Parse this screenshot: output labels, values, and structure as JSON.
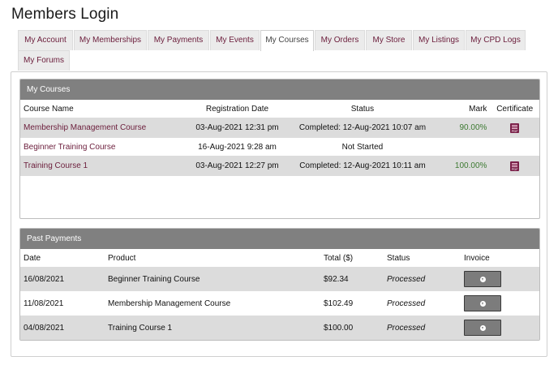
{
  "page": {
    "title": "Members Login"
  },
  "tabs": [
    {
      "label": "My Account"
    },
    {
      "label": "My Memberships"
    },
    {
      "label": "My Payments"
    },
    {
      "label": "My Events"
    },
    {
      "label": "My Courses",
      "active": true
    },
    {
      "label": "My Orders"
    },
    {
      "label": "My Store"
    },
    {
      "label": "My Listings"
    },
    {
      "label": "My CPD Logs"
    },
    {
      "label": "My Forums"
    }
  ],
  "courses": {
    "header": "My Courses",
    "columns": {
      "name": "Course Name",
      "date": "Registration Date",
      "status": "Status",
      "mark": "Mark",
      "certificate": "Certificate"
    },
    "rows": [
      {
        "name": "Membership Management Course",
        "date": "03-Aug-2021 12:31 pm",
        "status": "Completed: 12-Aug-2021 10:07 am",
        "mark": "90.00%",
        "certificate": "pdf-icon"
      },
      {
        "name": "Beginner Training Course",
        "date": "16-Aug-2021 9:28 am",
        "status": "Not Started",
        "mark": "",
        "certificate": ""
      },
      {
        "name": "Training Course 1",
        "date": "03-Aug-2021 12:27 pm",
        "status": "Completed: 12-Aug-2021 10:11 am",
        "mark": "100.00%",
        "certificate": "pdf-icon"
      }
    ]
  },
  "payments": {
    "header": "Past Payments",
    "columns": {
      "date": "Date",
      "product": "Product",
      "total": "Total ($)",
      "status": "Status",
      "invoice": "Invoice"
    },
    "rows": [
      {
        "date": "16/08/2021",
        "product": "Beginner Training Course",
        "total": "$92.34",
        "status": "Processed",
        "invoice": "download-icon"
      },
      {
        "date": "11/08/2021",
        "product": "Membership Management Course",
        "total": "$102.49",
        "status": "Processed",
        "invoice": "download-icon"
      },
      {
        "date": "04/08/2021",
        "product": "Training Course 1",
        "total": "$100.00",
        "status": "Processed",
        "invoice": "download-icon"
      }
    ]
  },
  "colors": {
    "accent": "#6b1d3b",
    "panel_header": "#808080",
    "mark_green": "#3d7a32",
    "row_shade": "#dcdcdc"
  }
}
